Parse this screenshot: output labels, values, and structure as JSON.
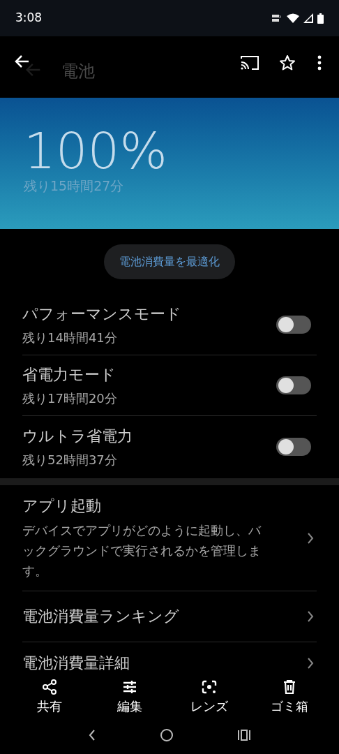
{
  "status_bar": {
    "time": "3:08"
  },
  "app_bar": {
    "title": "電池"
  },
  "battery": {
    "percent": "100%",
    "remaining": "残り15時間27分"
  },
  "optimize_button": {
    "label": "電池消費量を最適化"
  },
  "modes": [
    {
      "title": "パフォーマンスモード",
      "remaining": "残り14時間41分",
      "on": false
    },
    {
      "title": "省電力モード",
      "remaining": "残り17時間20分",
      "on": false
    },
    {
      "title": "ウルトラ省電力",
      "remaining": "残り52時間37分",
      "on": false
    }
  ],
  "menu_items": [
    {
      "title": "アプリ起動",
      "description": "デバイスでアプリがどのように起動し、バックグラウンドで実行されるかを管理します。"
    },
    {
      "title": "電池消費量ランキング"
    },
    {
      "title": "電池消費量詳細"
    }
  ],
  "photo_actions": [
    {
      "label": "共有"
    },
    {
      "label": "編集"
    },
    {
      "label": "レンズ"
    },
    {
      "label": "ゴミ箱"
    }
  ]
}
